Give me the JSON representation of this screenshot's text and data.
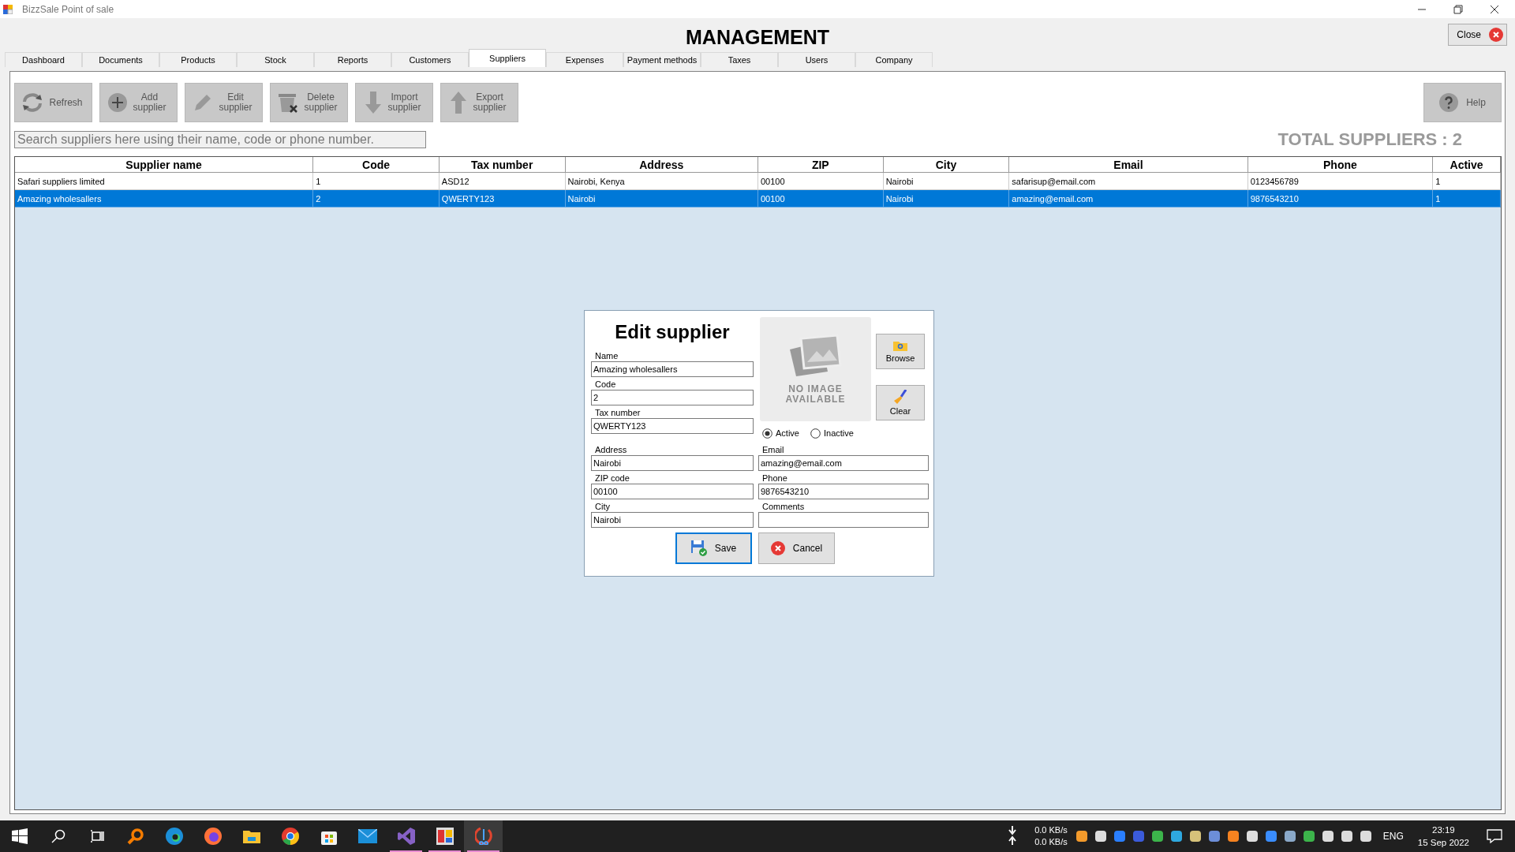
{
  "window": {
    "title": "BizzSale Point of sale"
  },
  "header": {
    "title": "MANAGEMENT",
    "close_button": "Close"
  },
  "tabs": [
    {
      "label": "Dashboard",
      "selected": false
    },
    {
      "label": "Documents",
      "selected": false
    },
    {
      "label": "Products",
      "selected": false
    },
    {
      "label": "Stock",
      "selected": false
    },
    {
      "label": "Reports",
      "selected": false
    },
    {
      "label": "Customers",
      "selected": false
    },
    {
      "label": "Suppliers",
      "selected": true
    },
    {
      "label": "Expenses",
      "selected": false
    },
    {
      "label": "Payment methods",
      "selected": false
    },
    {
      "label": "Taxes",
      "selected": false
    },
    {
      "label": "Users",
      "selected": false
    },
    {
      "label": "Company",
      "selected": false
    }
  ],
  "toolbar": [
    {
      "kind": "refresh",
      "label": "Refresh"
    },
    {
      "kind": "add",
      "label": "Add supplier"
    },
    {
      "kind": "edit",
      "label": "Edit supplier"
    },
    {
      "kind": "delete",
      "label": "Delete supplier"
    },
    {
      "kind": "import",
      "label": "Import supplier"
    },
    {
      "kind": "export",
      "label": "Export supplier"
    }
  ],
  "help_button": "Help",
  "search": {
    "placeholder": "Search suppliers here using their name, code or phone number."
  },
  "total": "TOTAL SUPPLIERS : 2",
  "table": {
    "columns": [
      "Supplier name",
      "Code",
      "Tax number",
      "Address",
      "ZIP",
      "City",
      "Email",
      "Phone",
      "Active"
    ],
    "rows": [
      {
        "selected": false,
        "cells": [
          "Safari suppliers limited",
          "1",
          "ASD12",
          "Nairobi, Kenya",
          "00100",
          "Nairobi",
          "safarisup@email.com",
          "0123456789",
          "1"
        ]
      },
      {
        "selected": true,
        "cells": [
          "Amazing wholesallers",
          "2",
          "QWERTY123",
          "Nairobi",
          "00100",
          "Nairobi",
          "amazing@email.com",
          "9876543210",
          "1"
        ]
      }
    ]
  },
  "dialog": {
    "title": "Edit supplier",
    "image_caption": "NO IMAGE AVAILABLE",
    "browse_button": "Browse",
    "clear_button": "Clear",
    "status": [
      {
        "label": "Active",
        "selected": true
      },
      {
        "label": "Inactive",
        "selected": false
      }
    ],
    "left_fields": [
      {
        "label": "Name",
        "value": "Amazing wholesallers"
      },
      {
        "label": "Code",
        "value": "2"
      },
      {
        "label": "Tax number",
        "value": "QWERTY123"
      }
    ],
    "pair_fields": [
      [
        {
          "label": "Address",
          "value": "Nairobi"
        },
        {
          "label": "Email",
          "value": "amazing@email.com"
        }
      ],
      [
        {
          "label": "ZIP code",
          "value": "00100"
        },
        {
          "label": "Phone",
          "value": "9876543210"
        }
      ],
      [
        {
          "label": "City",
          "value": "Nairobi"
        },
        {
          "label": "Comments"
        }
      ]
    ],
    "save_button": "Save",
    "cancel_button": "Cancel"
  },
  "taskbar": {
    "apps": [
      {
        "kind": "start",
        "running": false,
        "selected": false
      },
      {
        "kind": "search",
        "running": false,
        "selected": false
      },
      {
        "kind": "taskview",
        "running": false,
        "selected": false
      },
      {
        "kind": "magnifier",
        "running": false,
        "selected": false
      },
      {
        "kind": "edge",
        "running": false,
        "selected": false
      },
      {
        "kind": "firefox",
        "running": false,
        "selected": false
      },
      {
        "kind": "folder",
        "running": false,
        "selected": false
      },
      {
        "kind": "chrome",
        "running": false,
        "selected": false
      },
      {
        "kind": "store",
        "running": false,
        "selected": false
      },
      {
        "kind": "mail",
        "running": false,
        "selected": false
      },
      {
        "kind": "studio",
        "running": true,
        "selected": false
      },
      {
        "kind": "pos",
        "running": true,
        "selected": false
      },
      {
        "kind": "tool",
        "running": true,
        "selected": true
      }
    ],
    "net_down": "0.0 KB/s",
    "net_up": "0.0 KB/s",
    "language": "ENG",
    "time": "23:19",
    "date": "15 Sep 2022"
  }
}
